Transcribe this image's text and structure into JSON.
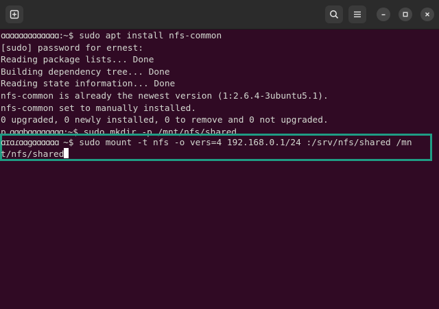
{
  "titlebar": {
    "icons": {
      "new_tab": "new-tab-icon",
      "search": "search-icon",
      "menu": "hamburger-icon",
      "minimize": "minimize-icon",
      "maximize": "maximize-icon",
      "close": "close-icon"
    }
  },
  "terminal": {
    "background": "#300a24",
    "highlight_color": "#1f9d84",
    "lines": [
      {
        "user": "ɑɑɑɑɑɑɑɑɑɑɑɑɑ:",
        "sep": "~$ ",
        "text": "sudo apt install nfs-common"
      },
      {
        "text": "[sudo] password for ernest:"
      },
      {
        "text": "Reading package lists... Done"
      },
      {
        "text": "Building dependency tree... Done"
      },
      {
        "text": "Reading state information... Done"
      },
      {
        "text": "nfs-common is already the newest version (1:2.6.4-3ubuntu5.1)."
      },
      {
        "text": "nfs-common set to manually installed."
      },
      {
        "text": "0 upgraded, 0 newly installed, 0 to remove and 0 not upgraded."
      },
      {
        "user": "ɒ ɑɑɑbɑɑɑɑɑɑɑɑ:",
        "sep": "~$ ",
        "text": "sudo mkdir -p /mnt/nfs/shared"
      },
      {
        "user": "ɑɪɑɾɑɑgɑɑɑɑɑɑ ",
        "sep": "~$ ",
        "text": "sudo mount -t nfs -o vers=4 192.168.0.1/24 :/srv/nfs/shared /mn"
      },
      {
        "text": "t/nfs/shared"
      }
    ]
  }
}
